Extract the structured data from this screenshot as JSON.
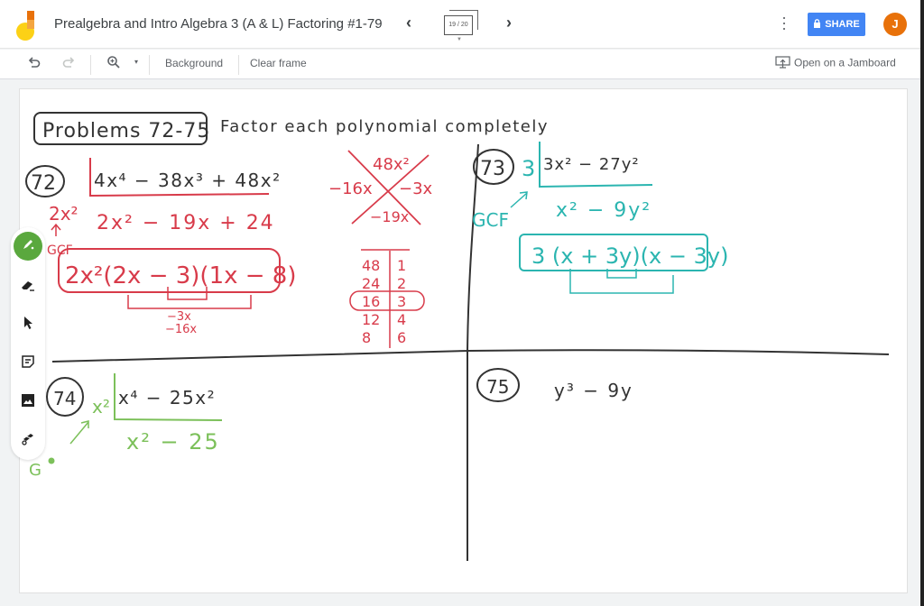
{
  "app": {
    "title": "Prealgebra and Intro Algebra 3 (A & L) Factoring #1-79",
    "frame_counter": "19 / 20",
    "share_label": "SHARE",
    "avatar_initial": "J",
    "brand_color": "#4285f4",
    "avatar_color": "#e8710a"
  },
  "toolbar": {
    "background_label": "Background",
    "clear_frame_label": "Clear frame",
    "open_jamboard_label": "Open on a Jamboard"
  },
  "side_tools": [
    {
      "name": "pen",
      "active": true
    },
    {
      "name": "eraser",
      "active": false
    },
    {
      "name": "select",
      "active": false
    },
    {
      "name": "sticky-note",
      "active": false
    },
    {
      "name": "image",
      "active": false
    },
    {
      "name": "laser",
      "active": false
    }
  ],
  "ink": {
    "colors": {
      "black": "#333333",
      "red": "#d83b4a",
      "teal": "#2bb5b0",
      "green": "#7cc05a"
    },
    "header": {
      "box_label": "Problems 72-75",
      "instruction": "Factor each polynomial completely"
    },
    "p72": {
      "number": "72",
      "gcf": "2x²",
      "gcf_note": "GCF",
      "polynomial": "4x⁴ − 38x³ + 48x²",
      "quotient": "2x² − 19x + 24",
      "answer": "2x²(2x − 3)(1x − 8)",
      "check_1": "−3x",
      "check_2": "−16x",
      "x_top": "48x²",
      "x_left": "−16x",
      "x_right": "−3x",
      "x_bottom": "−19x",
      "factor_pairs": [
        [
          "48",
          "1"
        ],
        [
          "24",
          "2"
        ],
        [
          "16",
          "3"
        ],
        [
          "12",
          "4"
        ],
        [
          "8",
          "6"
        ]
      ]
    },
    "p73": {
      "number": "73",
      "gcf": "3",
      "gcf_note": "GCF",
      "polynomial": "3x² − 27y²",
      "quotient": "x² − 9y²",
      "answer": "3 (x + 3y)(x − 3y)"
    },
    "p74": {
      "number": "74",
      "gcf": "x²",
      "gcf_note": "G",
      "polynomial": "x⁴ − 25x²",
      "quotient": "x² − 25"
    },
    "p75": {
      "number": "75",
      "polynomial": "y³ − 9y"
    }
  }
}
